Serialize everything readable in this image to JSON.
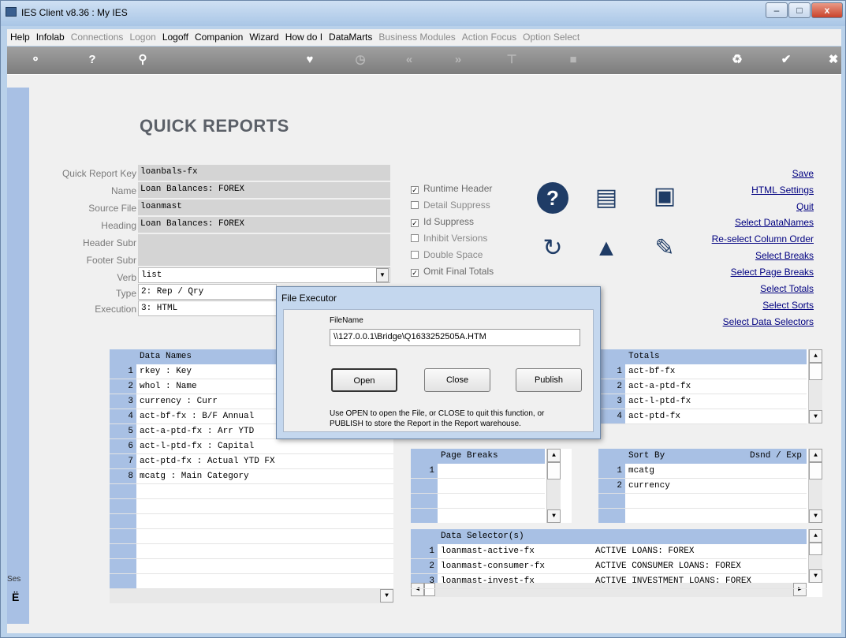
{
  "window": {
    "title": "IES Client v8.36 : My IES"
  },
  "menu": [
    {
      "label": "Help",
      "dim": false
    },
    {
      "label": "Infolab",
      "dim": false
    },
    {
      "label": "Connections",
      "dim": true
    },
    {
      "label": "Logon",
      "dim": true
    },
    {
      "label": "Logoff",
      "dim": false
    },
    {
      "label": "Companion",
      "dim": false
    },
    {
      "label": "Wizard",
      "dim": false
    },
    {
      "label": "How do I",
      "dim": false
    },
    {
      "label": "DataMarts",
      "dim": false
    },
    {
      "label": "Business Modules",
      "dim": true
    },
    {
      "label": "Action Focus",
      "dim": true
    },
    {
      "label": "Option Select",
      "dim": true
    }
  ],
  "page": {
    "heading": "QUICK REPORTS",
    "left_truncated": "Ses"
  },
  "form": {
    "labels": {
      "key": "Quick Report Key",
      "name": "Name",
      "source": "Source File",
      "heading": "Heading",
      "header_subr": "Header Subr",
      "footer_subr": "Footer Subr",
      "verb": "Verb",
      "type": "Type",
      "execution": "Execution"
    },
    "values": {
      "key": "loanbals-fx",
      "name": "Loan Balances: FOREX",
      "source": "loanmast",
      "heading": "Loan Balances: FOREX",
      "header_subr": "",
      "footer_subr": "",
      "verb": "list",
      "type": "2: Rep / Qry",
      "execution": "3: HTML"
    }
  },
  "options": {
    "runtime_header": "Runtime Header",
    "detail_suppress": "Detail Suppress",
    "id_suppress": "Id Suppress",
    "inhibit_versions": "Inhibit Versions",
    "double_space": "Double Space",
    "omit_final_totals": "Omit Final Totals"
  },
  "links": {
    "save": "Save",
    "html_settings": "HTML Settings",
    "quit": "Quit",
    "select_datanames": "Select DataNames",
    "reselect_column_order": "Re-select Column Order",
    "select_breaks": "Select Breaks",
    "select_page_breaks": "Select Page Breaks",
    "select_totals": "Select Totals",
    "select_sorts": "Select Sorts",
    "select_data_selectors": "Select Data Selectors"
  },
  "data_names": {
    "header": "Data Names",
    "rows": [
      {
        "n": "1",
        "text": "rkey : Key"
      },
      {
        "n": "2",
        "text": "whol : Name"
      },
      {
        "n": "3",
        "text": "currency : Curr"
      },
      {
        "n": "4",
        "text": "act-bf-fx : B/F Annual"
      },
      {
        "n": "5",
        "text": "act-a-ptd-fx : Arr YTD"
      },
      {
        "n": "6",
        "text": "act-l-ptd-fx : Capital"
      },
      {
        "n": "7",
        "text": "act-ptd-fx : Actual YTD FX"
      },
      {
        "n": "8",
        "text": "mcatg : Main Category"
      }
    ]
  },
  "totals": {
    "header": "Totals",
    "rows": [
      {
        "n": "1",
        "text": "act-bf-fx"
      },
      {
        "n": "2",
        "text": "act-a-ptd-fx"
      },
      {
        "n": "3",
        "text": "act-l-ptd-fx"
      },
      {
        "n": "4",
        "text": "act-ptd-fx"
      }
    ]
  },
  "page_breaks": {
    "header": "Page Breaks",
    "rows": [
      {
        "n": "1",
        "text": ""
      }
    ]
  },
  "sort_by": {
    "header": "Sort By",
    "header_right": "Dsnd / Exp",
    "rows": [
      {
        "n": "1",
        "text": "mcatg"
      },
      {
        "n": "2",
        "text": "currency"
      }
    ]
  },
  "data_selectors": {
    "header": "Data Selector(s)",
    "rows": [
      {
        "n": "1",
        "name": "loanmast-active-fx",
        "desc": "ACTIVE LOANS: FOREX"
      },
      {
        "n": "2",
        "name": "loanmast-consumer-fx",
        "desc": "ACTIVE CONSUMER LOANS: FOREX"
      },
      {
        "n": "3",
        "name": "loanmast-invest-fx",
        "desc": "ACTIVE INVESTMENT LOANS: FOREX"
      }
    ]
  },
  "dialog": {
    "title": "File Executor",
    "filename_label": "FileName",
    "filename_value": "\\\\127.0.0.1\\Bridge\\Q1633252505A.HTM",
    "open": "Open",
    "close": "Close",
    "publish": "Publish",
    "help_line1": "Use OPEN to open the File, or CLOSE to quit this function, or",
    "help_line2": "PUBLISH to store the Report in the Report warehouse."
  }
}
